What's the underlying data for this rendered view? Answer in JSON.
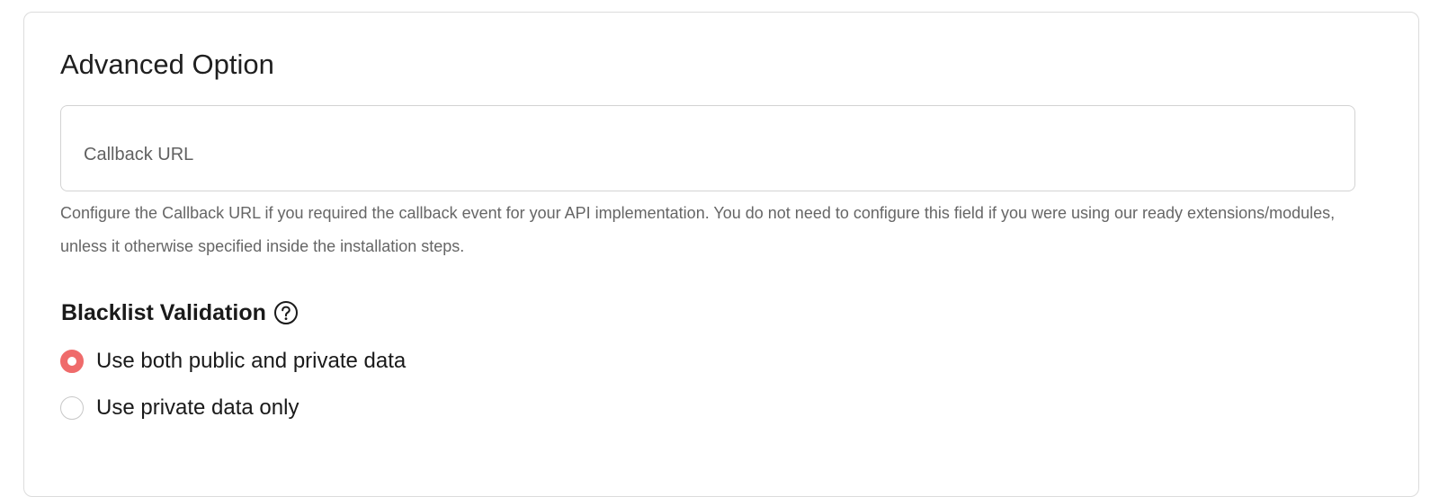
{
  "section": {
    "title": "Advanced Option"
  },
  "callback": {
    "placeholder": "Callback URL",
    "value": "",
    "help": "Configure the Callback URL if you required the callback event for your API implementation. You do not need to configure this field if you were using our ready extensions/modules, unless it otherwise specified inside the installation steps."
  },
  "blacklist": {
    "title": "Blacklist Validation",
    "help_icon": "question-circle-icon",
    "options": [
      {
        "label": "Use both public and private data",
        "selected": true
      },
      {
        "label": "Use private data only",
        "selected": false
      }
    ]
  },
  "colors": {
    "accent": "#ef6b6b",
    "border": "#d3d3d3",
    "help_text": "#666666"
  }
}
